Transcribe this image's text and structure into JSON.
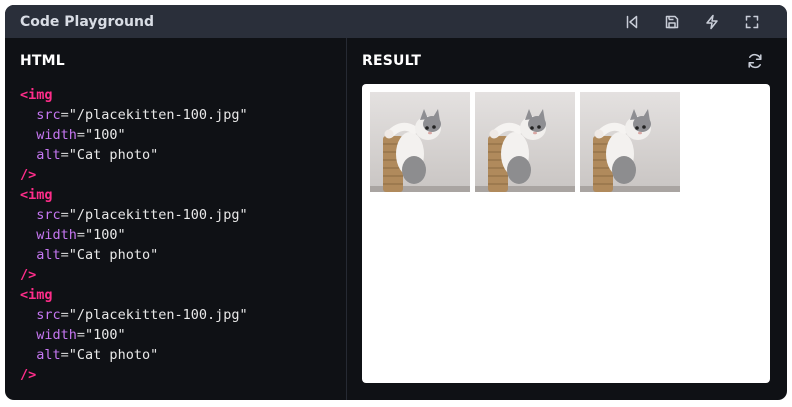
{
  "window": {
    "title": "Code Playground"
  },
  "toolbar": {
    "icons": [
      "skip-back-icon",
      "save-icon",
      "zap-icon",
      "fullscreen-icon"
    ]
  },
  "editor": {
    "label": "HTML",
    "blocks": [
      {
        "open": "<img",
        "src_attr": "src",
        "src_val": "\"/placekitten-100.jpg\"",
        "width_attr": "width",
        "width_val": "\"100\"",
        "alt_attr": "alt",
        "alt_val": "\"Cat photo\"",
        "close": "/>"
      },
      {
        "open": "<img",
        "src_attr": "src",
        "src_val": "\"/placekitten-100.jpg\"",
        "width_attr": "width",
        "width_val": "\"100\"",
        "alt_attr": "alt",
        "alt_val": "\"Cat photo\"",
        "close": "/>"
      },
      {
        "open": "<img",
        "src_attr": "src",
        "src_val": "\"/placekitten-100.jpg\"",
        "width_attr": "width",
        "width_val": "\"100\"",
        "alt_attr": "alt",
        "alt_val": "\"Cat photo\"",
        "close": "/>"
      }
    ]
  },
  "result": {
    "label": "RESULT",
    "refresh_icon": "refresh-icon",
    "images": [
      "kitten-image",
      "kitten-image",
      "kitten-image"
    ]
  },
  "colors": {
    "background": "#0f1115",
    "titlebar": "#2a2f3a",
    "tag": "#ff2d8a",
    "attribute": "#c677f2"
  }
}
